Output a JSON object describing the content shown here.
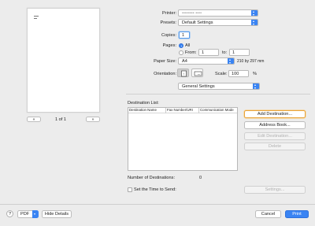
{
  "preview": {
    "page_indicator": "1 of 1",
    "prev_label": "«",
    "next_label": "»"
  },
  "settings": {
    "printer_label": "Printer:",
    "printer_value": "•••••••• ••••",
    "presets_label": "Presets:",
    "presets_value": "Default Settings",
    "copies_label": "Copies:",
    "copies_value": "1",
    "pages_label": "Pages:",
    "pages_all": "All",
    "pages_from": "From:",
    "pages_from_value": "1",
    "pages_to": "to:",
    "pages_to_value": "1",
    "paper_size_label": "Paper Size:",
    "paper_size_value": "A4",
    "paper_size_dims": "210 by 297 mm",
    "orientation_label": "Orientation:",
    "scale_label": "Scale:",
    "scale_value": "100",
    "scale_unit": "%",
    "section_value": "General Settings"
  },
  "destination": {
    "list_label": "Destination List:",
    "columns": [
      "Destination Name",
      "Fax Number/URI",
      "Communication Mode"
    ],
    "add_button": "Add Destination...",
    "address_book_button": "Address Book...",
    "edit_button": "Edit Destination...",
    "delete_button": "Delete",
    "count_label": "Number of Destinations:",
    "count_value": "0",
    "set_time_label": "Set the Time to Send:",
    "settings_button": "Settings..."
  },
  "footer": {
    "help": "?",
    "pdf": "PDF",
    "hide_details": "Hide Details",
    "cancel": "Cancel",
    "print": "Print"
  },
  "colors": {
    "accent": "#3a84f3",
    "highlight": "#e8a33a",
    "window_bg": "#ececec"
  }
}
